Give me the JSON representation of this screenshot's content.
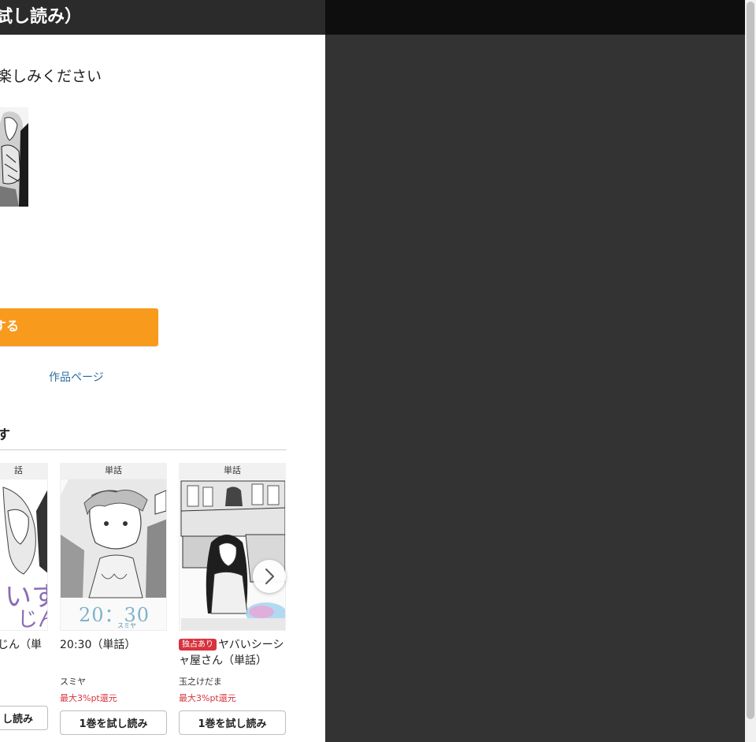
{
  "header": {
    "title": "試し読み）"
  },
  "intro": {
    "text": "楽しみください"
  },
  "cta": {
    "label": "する"
  },
  "links": {
    "work_page": "作品ページ"
  },
  "section": {
    "title": "す"
  },
  "cards": [
    {
      "tag": "話",
      "title": "じん（単",
      "author": "",
      "points": "",
      "button": "し読み",
      "badge": ""
    },
    {
      "tag": "単話",
      "title": "20:30（単話）",
      "author": "スミヤ",
      "points": "最大3%pt還元",
      "button": "1巻を試し読み",
      "badge": ""
    },
    {
      "tag": "単話",
      "title": "ヤバいシーシャ屋さん（単話）",
      "author": "玉之けだま",
      "points": "最大3%pt還元",
      "button": "1巻を試し読み",
      "badge": "独占あり"
    }
  ],
  "cover_text": {
    "card1": "20：30",
    "card1_author": "スミヤ"
  },
  "colors": {
    "accent": "#f89a1c",
    "link": "#2e6fa3",
    "points": "#d8333e",
    "backdrop": "#333333"
  },
  "icons": {
    "next": "chevron-right-icon"
  }
}
